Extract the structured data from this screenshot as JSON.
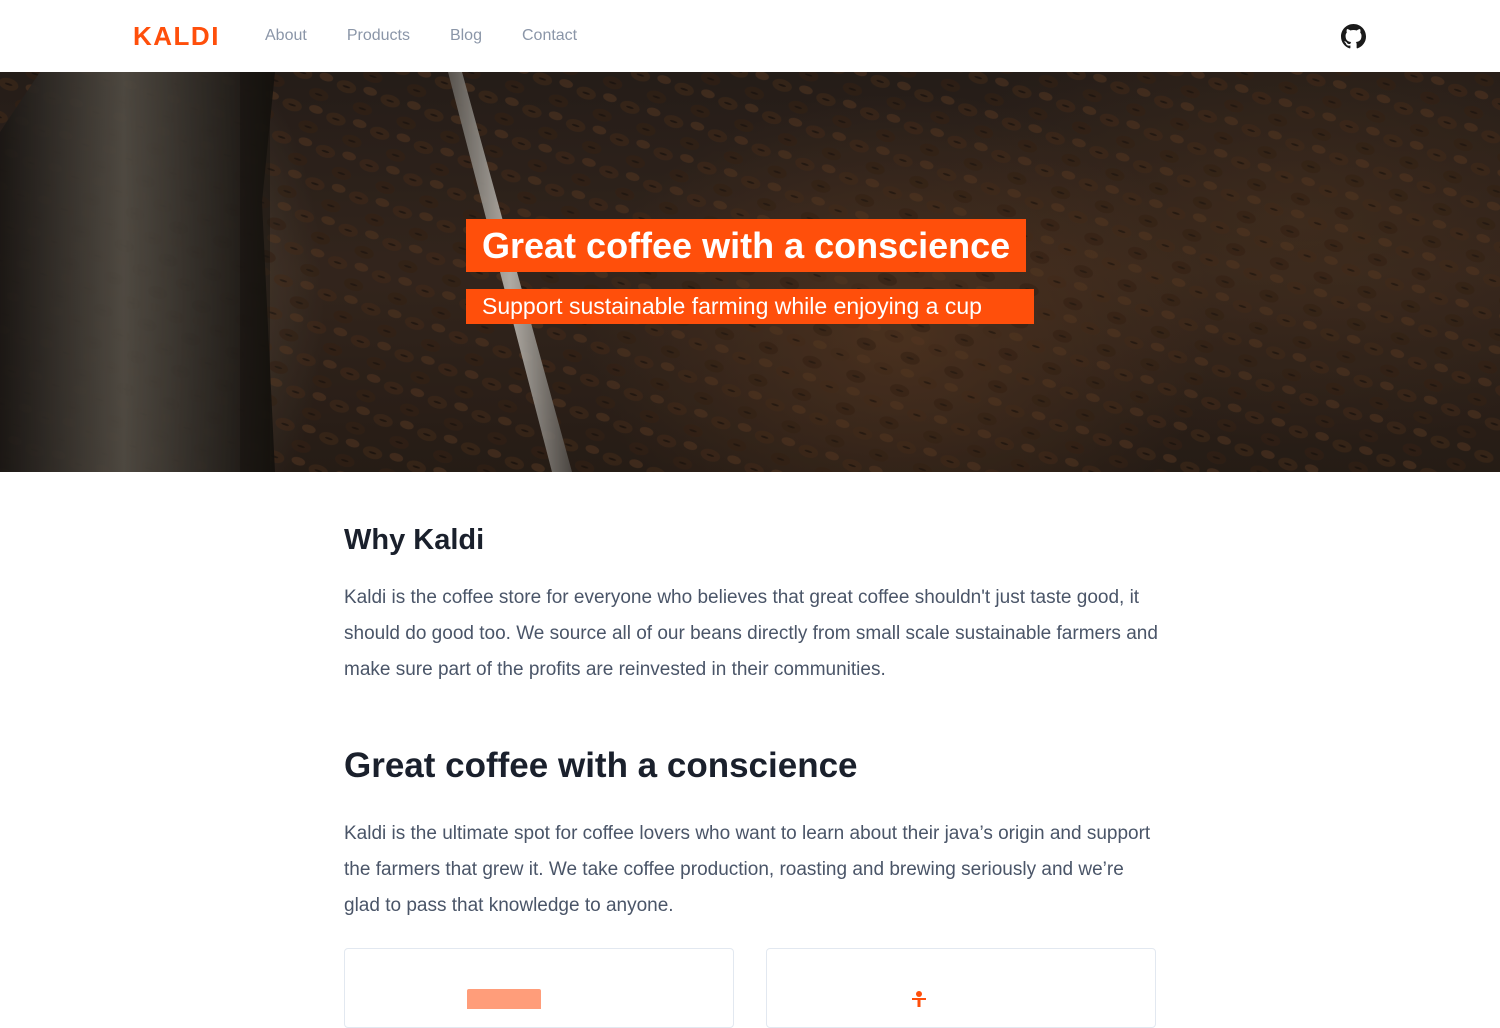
{
  "navbar": {
    "logo": "KALDI",
    "links": [
      "About",
      "Products",
      "Blog",
      "Contact"
    ],
    "github_icon": "github-icon"
  },
  "hero": {
    "title": "Great coffee with a conscience",
    "subtitle": "Support sustainable farming while enjoying a cup"
  },
  "intro": {
    "heading": "Why Kaldi",
    "body": "Kaldi is the coffee store for everyone who believes that great coffee shouldn't just taste good, it should do good too. We source all of our beans directly from small scale sustainable farmers and make sure part of the profits are reinvested in their communities."
  },
  "section": {
    "heading": "Great coffee with a conscience",
    "body": "Kaldi is the ultimate spot for coffee lovers who want to learn about their java’s origin and support the farmers that grew it. We take coffee production, roasting and brewing seriously and we’re glad to pass that knowledge to anyone."
  },
  "colors": {
    "brand": "#ff4f0b",
    "nav_link": "#8b96a8",
    "heading": "#1a202c",
    "body_text": "#4a5568"
  }
}
